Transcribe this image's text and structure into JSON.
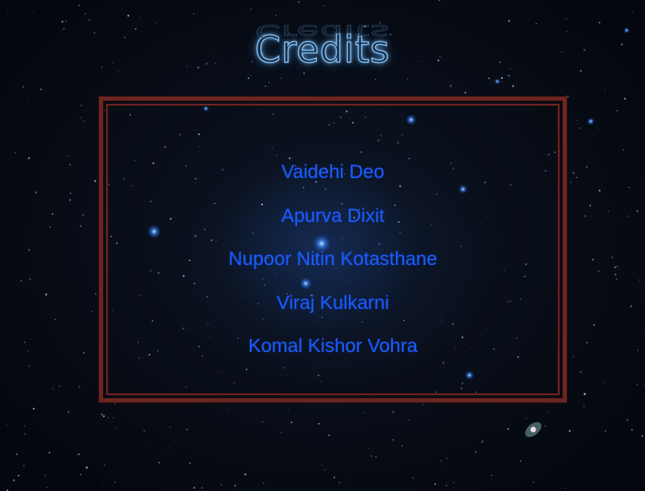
{
  "screen": {
    "title": "Credits"
  },
  "credits": {
    "names": [
      "Vaidehi Deo",
      "Apurva Dixit",
      "Nupoor Nitin Kotasthane",
      "Viraj Kulkarni",
      "Komal Kishor Vohra"
    ]
  },
  "colors": {
    "title_glow": "#7fb9ea",
    "frame": "#6b2622",
    "name_text": "#1a5cff",
    "background": "#070b14"
  }
}
